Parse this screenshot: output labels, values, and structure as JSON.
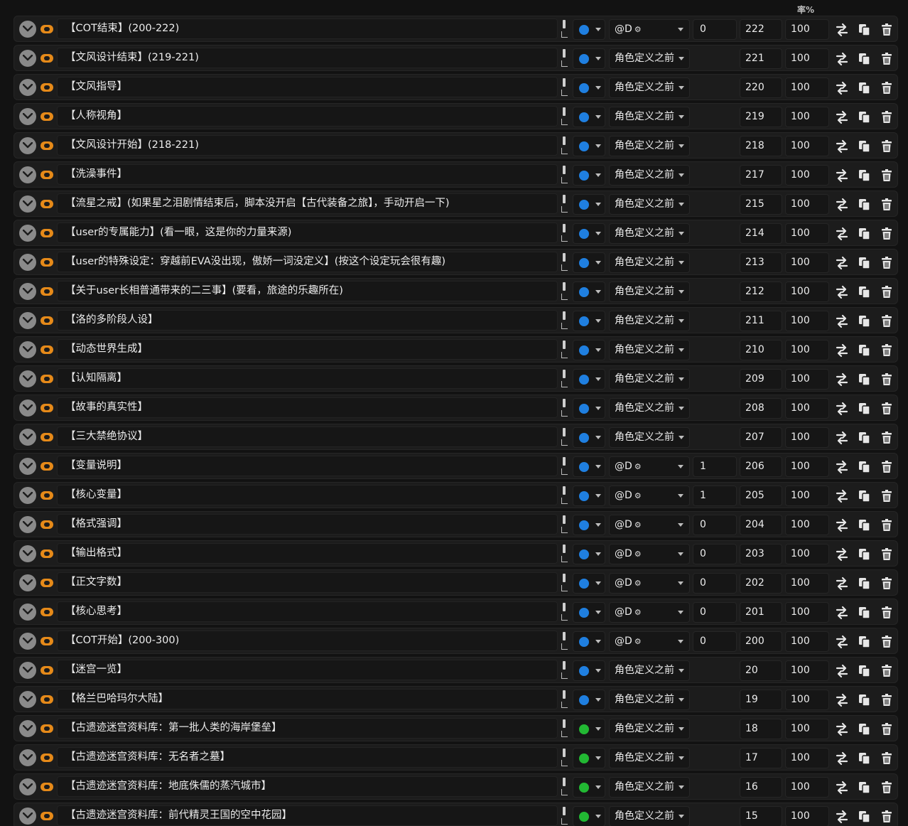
{
  "header": {
    "probability_label": "率%"
  },
  "colors": {
    "blue": "#1f7fe0",
    "green": "#22b833",
    "toggle": "#e68a19"
  },
  "icons": {
    "expand": "chevron-down-icon",
    "enable": "toggle-icon",
    "swap": "swap-icon",
    "copy": "copy-icon",
    "delete": "trash-icon"
  },
  "entries": [
    {
      "title": "【COT结束】(200-222)",
      "status": "blue",
      "position": "@D",
      "at_depth": true,
      "depth": "0",
      "order": "222",
      "probability": "100"
    },
    {
      "title": "【文风设计结束】(219-221)",
      "status": "blue",
      "position": "角色定义之前",
      "at_depth": false,
      "depth": "",
      "order": "221",
      "probability": "100"
    },
    {
      "title": "【文风指导】",
      "status": "blue",
      "position": "角色定义之前",
      "at_depth": false,
      "depth": "",
      "order": "220",
      "probability": "100"
    },
    {
      "title": "【人称视角】",
      "status": "blue",
      "position": "角色定义之前",
      "at_depth": false,
      "depth": "",
      "order": "219",
      "probability": "100"
    },
    {
      "title": "【文风设计开始】(218-221)",
      "status": "blue",
      "position": "角色定义之前",
      "at_depth": false,
      "depth": "",
      "order": "218",
      "probability": "100"
    },
    {
      "title": "【洗澡事件】",
      "status": "blue",
      "position": "角色定义之前",
      "at_depth": false,
      "depth": "",
      "order": "217",
      "probability": "100"
    },
    {
      "title": "【流星之戒】(如果星之泪剧情结束后，脚本没开启【古代装备之旅】，手动开启一下)",
      "status": "blue",
      "position": "角色定义之前",
      "at_depth": false,
      "depth": "",
      "order": "215",
      "probability": "100"
    },
    {
      "title": "【user的专属能力】(看一眼，这是你的力量来源)",
      "status": "blue",
      "position": "角色定义之前",
      "at_depth": false,
      "depth": "",
      "order": "214",
      "probability": "100"
    },
    {
      "title": "【user的特殊设定：穿越前EVA没出现，傲娇一词没定义】(按这个设定玩会很有趣)",
      "status": "blue",
      "position": "角色定义之前",
      "at_depth": false,
      "depth": "",
      "order": "213",
      "probability": "100"
    },
    {
      "title": "【关于user长相普通带来的二三事】(要看，旅途的乐趣所在)",
      "status": "blue",
      "position": "角色定义之前",
      "at_depth": false,
      "depth": "",
      "order": "212",
      "probability": "100"
    },
    {
      "title": "【洛的多阶段人设】",
      "status": "blue",
      "position": "角色定义之前",
      "at_depth": false,
      "depth": "",
      "order": "211",
      "probability": "100"
    },
    {
      "title": "【动态世界生成】",
      "status": "blue",
      "position": "角色定义之前",
      "at_depth": false,
      "depth": "",
      "order": "210",
      "probability": "100"
    },
    {
      "title": "【认知隔离】",
      "status": "blue",
      "position": "角色定义之前",
      "at_depth": false,
      "depth": "",
      "order": "209",
      "probability": "100"
    },
    {
      "title": "【故事的真实性】",
      "status": "blue",
      "position": "角色定义之前",
      "at_depth": false,
      "depth": "",
      "order": "208",
      "probability": "100"
    },
    {
      "title": "【三大禁绝协议】",
      "status": "blue",
      "position": "角色定义之前",
      "at_depth": false,
      "depth": "",
      "order": "207",
      "probability": "100"
    },
    {
      "title": "【变量说明】",
      "status": "blue",
      "position": "@D",
      "at_depth": true,
      "depth": "1",
      "order": "206",
      "probability": "100"
    },
    {
      "title": "【核心变量】",
      "status": "blue",
      "position": "@D",
      "at_depth": true,
      "depth": "1",
      "order": "205",
      "probability": "100"
    },
    {
      "title": "【格式强调】",
      "status": "blue",
      "position": "@D",
      "at_depth": true,
      "depth": "0",
      "order": "204",
      "probability": "100"
    },
    {
      "title": "【输出格式】",
      "status": "blue",
      "position": "@D",
      "at_depth": true,
      "depth": "0",
      "order": "203",
      "probability": "100"
    },
    {
      "title": "【正文字数】",
      "status": "blue",
      "position": "@D",
      "at_depth": true,
      "depth": "0",
      "order": "202",
      "probability": "100"
    },
    {
      "title": "【核心思考】",
      "status": "blue",
      "position": "@D",
      "at_depth": true,
      "depth": "0",
      "order": "201",
      "probability": "100"
    },
    {
      "title": "【COT开始】(200-300)",
      "status": "blue",
      "position": "@D",
      "at_depth": true,
      "depth": "0",
      "order": "200",
      "probability": "100"
    },
    {
      "title": "【迷宫一览】",
      "status": "blue",
      "position": "角色定义之前",
      "at_depth": false,
      "depth": "",
      "order": "20",
      "probability": "100"
    },
    {
      "title": "【格兰巴哈玛尔大陆】",
      "status": "blue",
      "position": "角色定义之前",
      "at_depth": false,
      "depth": "",
      "order": "19",
      "probability": "100"
    },
    {
      "title": "【古遗迹迷宫资料库：第一批人类的海岸堡垒】",
      "status": "green",
      "position": "角色定义之前",
      "at_depth": false,
      "depth": "",
      "order": "18",
      "probability": "100"
    },
    {
      "title": "【古遗迹迷宫资料库：无名者之墓】",
      "status": "green",
      "position": "角色定义之前",
      "at_depth": false,
      "depth": "",
      "order": "17",
      "probability": "100"
    },
    {
      "title": "【古遗迹迷宫资料库：地底侏儒的蒸汽城市】",
      "status": "green",
      "position": "角色定义之前",
      "at_depth": false,
      "depth": "",
      "order": "16",
      "probability": "100"
    },
    {
      "title": "【古遗迹迷宫资料库：前代精灵王国的空中花园】",
      "status": "green",
      "position": "角色定义之前",
      "at_depth": false,
      "depth": "",
      "order": "15",
      "probability": "100"
    }
  ]
}
